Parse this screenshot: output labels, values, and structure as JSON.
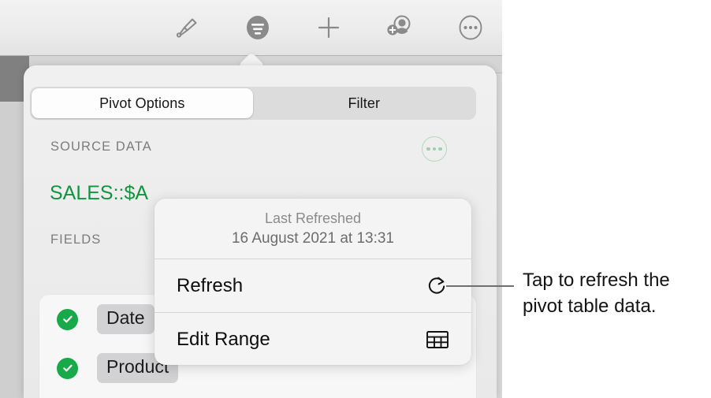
{
  "toolbar": {
    "icons": [
      {
        "name": "paintbrush-icon",
        "label": "Format"
      },
      {
        "name": "pivot-filter-icon",
        "label": "Organize"
      },
      {
        "name": "plus-icon",
        "label": "Insert"
      },
      {
        "name": "collaborate-icon",
        "label": "Collaborate"
      },
      {
        "name": "more-ellipsis-icon",
        "label": "More"
      }
    ]
  },
  "panel": {
    "tabs": [
      {
        "label": "Pivot Options",
        "selected": true
      },
      {
        "label": "Filter",
        "selected": false
      }
    ],
    "source_section": {
      "label": "SOURCE DATA",
      "value": "SALES::$A",
      "more_button_name": "source-data-more-button"
    },
    "fields_section": {
      "label": "FIELDS",
      "rows": [
        {
          "name": "Date",
          "checked": true
        },
        {
          "name": "Product",
          "checked": true
        }
      ]
    }
  },
  "popover": {
    "header": {
      "title": "Last Refreshed",
      "timestamp": "16 August 2021  at 13:31"
    },
    "items": [
      {
        "label": "Refresh",
        "icon": "refresh-arrow-icon"
      },
      {
        "label": "Edit Range",
        "icon": "table-grid-icon"
      }
    ]
  },
  "callout": {
    "text": "Tap to refresh the pivot table data."
  },
  "colors": {
    "accent_green": "#12943f",
    "check_green": "#18a94a",
    "toolbar_icon": "#8a8a8a",
    "callout_line": "#6f6f6f"
  }
}
